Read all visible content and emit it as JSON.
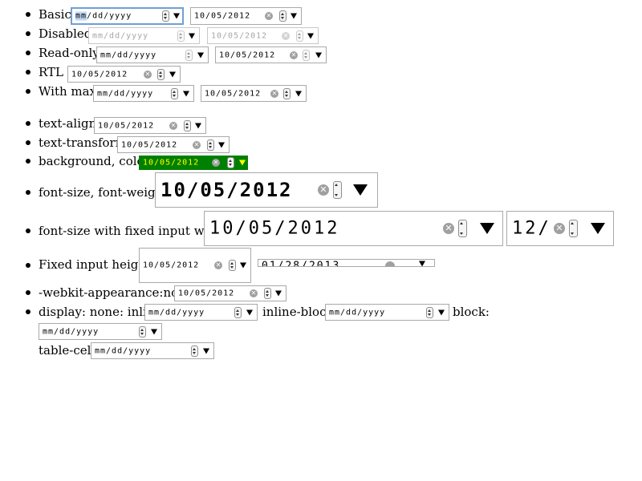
{
  "rows": [
    {
      "label": "Basic",
      "inputs": [
        "mm/dd/yyyy",
        "10/05/2012"
      ],
      "focused_segment": "mm"
    },
    {
      "label": "Disabled",
      "inputs": [
        "mm/dd/yyyy",
        "10/05/2012"
      ]
    },
    {
      "label": "Read-only",
      "inputs": [
        "mm/dd/yyyy",
        "10/05/2012"
      ]
    },
    {
      "label": "RTL",
      "inputs": [
        "10/05/2012"
      ]
    },
    {
      "label": "With max",
      "inputs": [
        "mm/dd/yyyy",
        "10/05/2012"
      ]
    },
    {
      "label": "text-align:",
      "inputs": [
        "10/05/2012"
      ]
    },
    {
      "label": "text-transform:",
      "inputs": [
        "10/05/2012"
      ]
    },
    {
      "label": "background, color:",
      "inputs": [
        "10/05/2012"
      ]
    },
    {
      "label": "font-size, font-weight:",
      "inputs": [
        "10/05/2012"
      ]
    },
    {
      "label": "font-size with fixed input width:",
      "inputs": [
        "10/05/2012",
        "12/"
      ]
    },
    {
      "label": "Fixed input height:",
      "inputs": [
        "10/05/2012",
        "01/28/2013"
      ]
    },
    {
      "label": "-webkit-appearance:none:",
      "inputs": [
        "10/05/2012"
      ]
    },
    {
      "label": "display: none: inline:",
      "inputs": [
        "mm/dd/yyyy"
      ],
      "inline_block_label": "inline-block:",
      "inline_block_value": "mm/dd/yyyy",
      "block_label": "block:",
      "block_value": "mm/dd/yyyy"
    },
    {
      "label": "table-cell:",
      "inputs": [
        "mm/dd/yyyy"
      ]
    }
  ],
  "icons": {
    "clear": "clear-icon",
    "spin": "spin-buttons-icon",
    "dropdown": "dropdown-arrow-icon"
  }
}
